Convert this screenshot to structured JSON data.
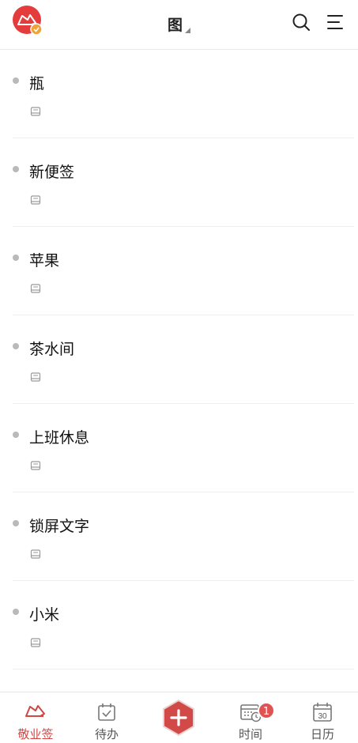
{
  "header": {
    "title": "图"
  },
  "notes": [
    {
      "title": "瓶"
    },
    {
      "title": "新便签"
    },
    {
      "title": "苹果"
    },
    {
      "title": "茶水间"
    },
    {
      "title": "上班休息"
    },
    {
      "title": "锁屏文字"
    },
    {
      "title": "小米"
    }
  ],
  "bottom_nav": {
    "items": [
      {
        "label": "敬业签",
        "icon": "app-logo-icon",
        "active": true
      },
      {
        "label": "待办",
        "icon": "todo-icon",
        "active": false
      },
      {
        "label": "时间",
        "icon": "time-icon",
        "active": false,
        "badge": "1"
      },
      {
        "label": "日历",
        "icon": "calendar-icon",
        "active": false,
        "day": "30"
      }
    ],
    "add_icon": "plus-icon"
  },
  "colors": {
    "accent": "#cf4846",
    "badge": "#e05353",
    "bullet": "#b9b9b9"
  }
}
